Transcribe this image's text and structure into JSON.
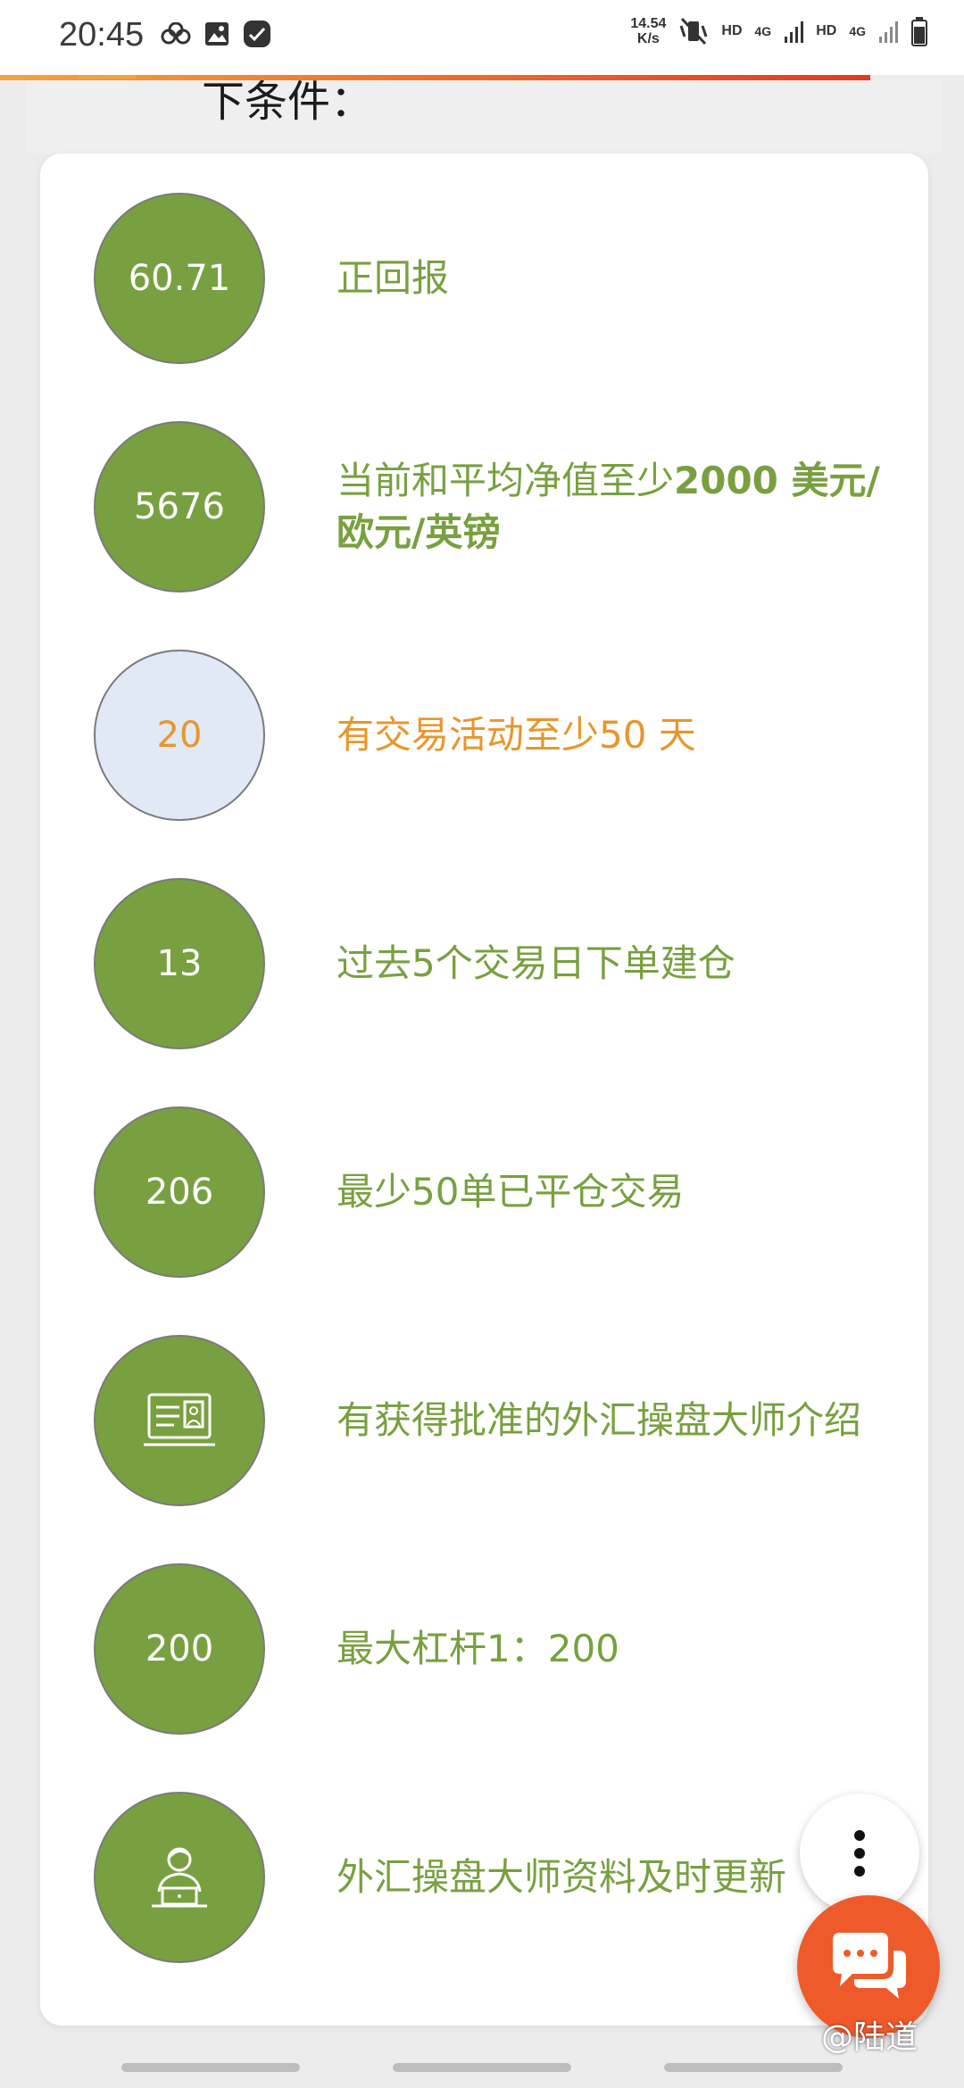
{
  "status_bar": {
    "time": "20:45",
    "net_speed_value": "14.54",
    "net_speed_unit": "K/s",
    "hd1": "HD",
    "net1": "4G",
    "hd2": "HD",
    "net2": "4G"
  },
  "header": {
    "partial_title": "下条件："
  },
  "conditions": [
    {
      "value": "60.71",
      "text": "正回报",
      "status": "met"
    },
    {
      "value": "5676",
      "text_prefix": "当前和平均净值至少",
      "text_bold": "2000 美元/欧元/英镑",
      "status": "met"
    },
    {
      "value": "20",
      "text": "有交易活动至少50 天",
      "status": "pending"
    },
    {
      "value": "13",
      "text": "过去5个交易日下单建仓",
      "status": "met"
    },
    {
      "value": "206",
      "text": "最少50单已平仓交易",
      "status": "met"
    },
    {
      "icon": "id-card-icon",
      "text": "有获得批准的外汇操盘大师介绍",
      "status": "met"
    },
    {
      "value": "200",
      "text": "最大杠杆1：200",
      "status": "met"
    },
    {
      "icon": "trader-at-laptop-icon",
      "text": "外汇操盘大师资料及时更新",
      "status": "met"
    }
  ],
  "watermark": "@陆道",
  "colors": {
    "met": "#78a040",
    "pending": "#e8962c",
    "pending_bg": "#e1e9f7",
    "chat_button": "#ef5a2b"
  }
}
